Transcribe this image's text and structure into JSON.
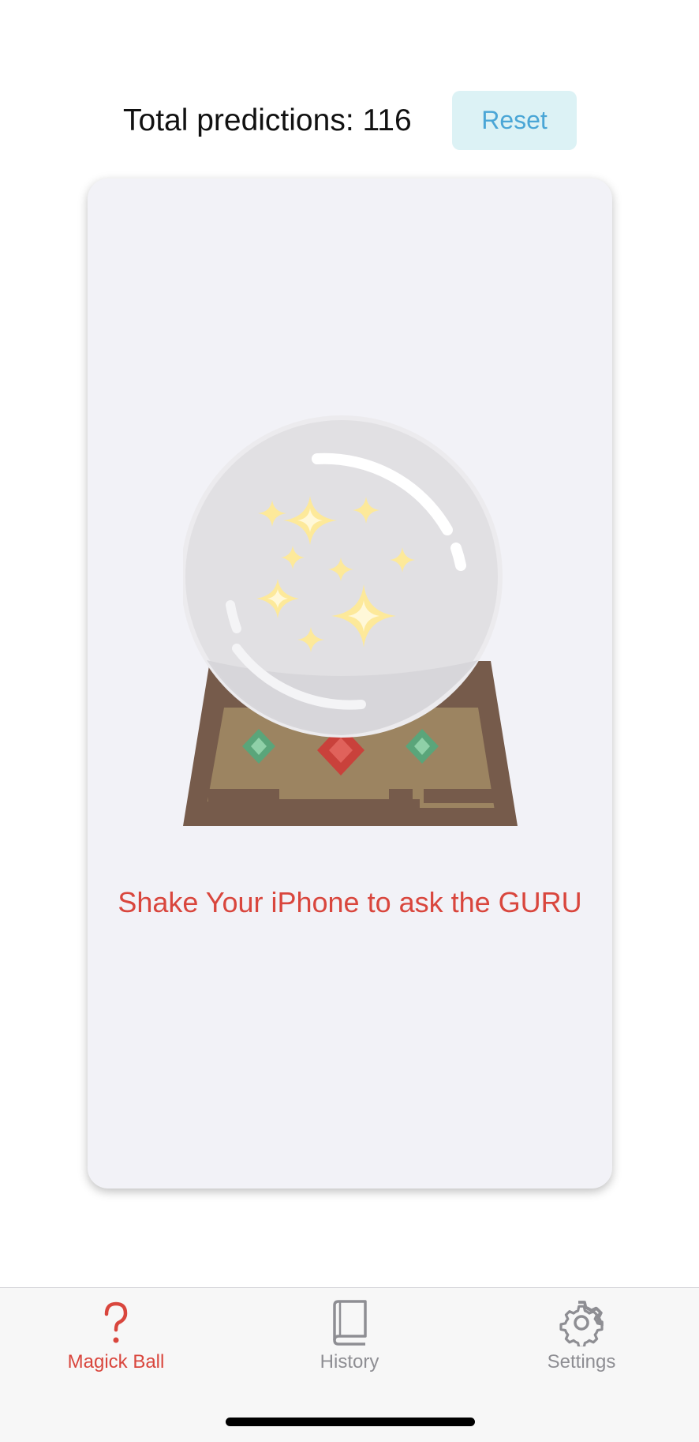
{
  "header": {
    "total_predictions_label": "Total predictions: 116",
    "reset_label": "Reset"
  },
  "card": {
    "prompt": "Shake Your iPhone to ask the GURU",
    "illustration": "crystal-ball-icon"
  },
  "tabbar": {
    "tabs": [
      {
        "label": "Magick Ball",
        "icon": "question-mark-icon",
        "active": true
      },
      {
        "label": "History",
        "icon": "book-icon",
        "active": false
      },
      {
        "label": "Settings",
        "icon": "gear-icon",
        "active": false
      }
    ]
  },
  "colors": {
    "accent": "#d9463d",
    "reset_bg": "#dcf2f5",
    "reset_text": "#4aa6d6",
    "card_bg": "#f2f2f7",
    "inactive_tab": "#8e8e93"
  }
}
